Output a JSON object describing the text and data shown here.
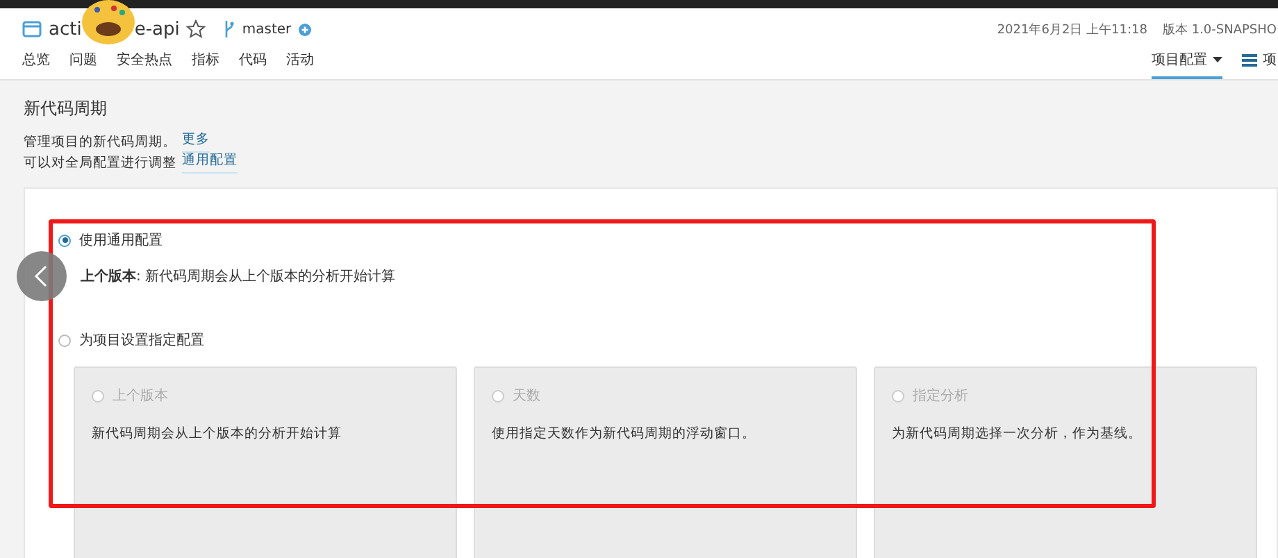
{
  "header": {
    "project_name_start": "acti",
    "project_name_end": "e-api",
    "branch": "master",
    "timestamp": "2021年6月2日 上午11:18",
    "version": "版本 1.0-SNAPSHO"
  },
  "nav": {
    "tabs": [
      {
        "label": "总览",
        "selected": false
      },
      {
        "label": "问题",
        "selected": false
      },
      {
        "label": "安全热点",
        "selected": false
      },
      {
        "label": "指标",
        "selected": false
      },
      {
        "label": "代码",
        "selected": false
      },
      {
        "label": "活动",
        "selected": false
      }
    ],
    "right_tabs": [
      {
        "label": "项目配置",
        "selected": true,
        "kind": "dropdown"
      },
      {
        "label": "项",
        "selected": false,
        "kind": "list"
      }
    ]
  },
  "page": {
    "title": "新代码周期",
    "description": "管理项目的新代码周期。",
    "more_link": "更多",
    "note": "可以对全局配置进行调整",
    "note_link": "通用配置"
  },
  "options": [
    {
      "label": "使用通用配置",
      "selected": true,
      "detail": "**上个版本**: 新代码周期会从上个版本的分析开始计算"
    },
    {
      "label": "为项目设置指定配置",
      "selected": false
    }
  ],
  "cards": [
    {
      "label": "上个版本",
      "selected": false,
      "description": "新代码周期会从上个版本的分析开始计算"
    },
    {
      "label": "天数",
      "selected": false,
      "description": "使用指定天数作为新代码周期的浮动窗口。"
    },
    {
      "label": "指定分析",
      "selected": false,
      "description": "为新代码周期选择一次分析，作为基线。"
    }
  ]
}
